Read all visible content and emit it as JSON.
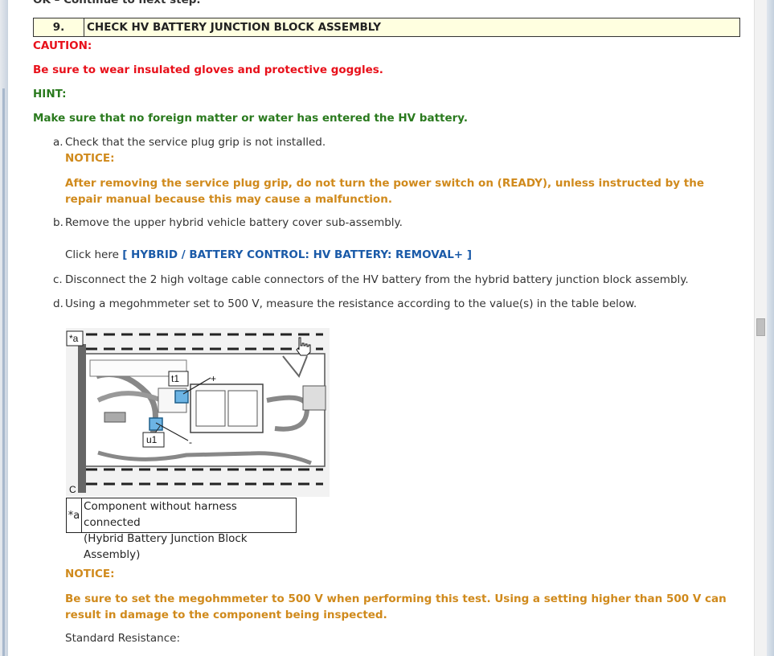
{
  "top_cut_text": "OK – Continue to next step.",
  "step": {
    "number": "9.",
    "title": "CHECK HV BATTERY JUNCTION BLOCK ASSEMBLY"
  },
  "caution": {
    "label": "CAUTION:",
    "text": "Be sure to wear insulated gloves and protective goggles."
  },
  "hint": {
    "label": "HINT:",
    "text": "Make sure that no foreign matter or water has entered the HV battery."
  },
  "items": {
    "a": {
      "marker": "a.",
      "text": "Check that the service plug grip is not installed."
    },
    "notice1": {
      "label": "NOTICE:",
      "text": "After removing the service plug grip, do not turn the power switch on (READY), unless instructed by the repair manual because this may cause a malfunction."
    },
    "b": {
      "marker": "b.",
      "text": "Remove the upper hybrid vehicle battery cover sub-assembly."
    },
    "click": {
      "prefix": "Click here",
      "link": "[ HYBRID / BATTERY CONTROL: HV BATTERY: REMOVAL+ ]"
    },
    "c": {
      "marker": "c.",
      "text": "Disconnect the 2 high voltage cable connectors of the HV battery from the hybrid battery junction block assembly."
    },
    "d": {
      "marker": "d.",
      "text": "Using a megohmmeter set to 500 V, measure the resistance according to the value(s) in the table below."
    }
  },
  "figure": {
    "corner_label": "*a",
    "terminal_t1": "t1",
    "terminal_u1": "u1",
    "plus": "+",
    "minus": "-",
    "bottom_label": "C"
  },
  "legend": {
    "key": "*a",
    "line1": "Component without harness connected",
    "line2": "(Hybrid Battery Junction Block Assembly)"
  },
  "notice2": {
    "label": "NOTICE:",
    "text": "Be sure to set the megohmmeter to 500 V when performing this test. Using a setting higher than 500 V can result in damage to the component being inspected."
  },
  "standard_resistance": "Standard Resistance:",
  "colors": {
    "caution": "#e8101a",
    "hint": "#2a7a1e",
    "notice": "#d08a1c",
    "link": "#1a5aa8",
    "step_bg": "#ffffe0"
  },
  "icons": {
    "cursor": "hand-pointer-icon"
  }
}
